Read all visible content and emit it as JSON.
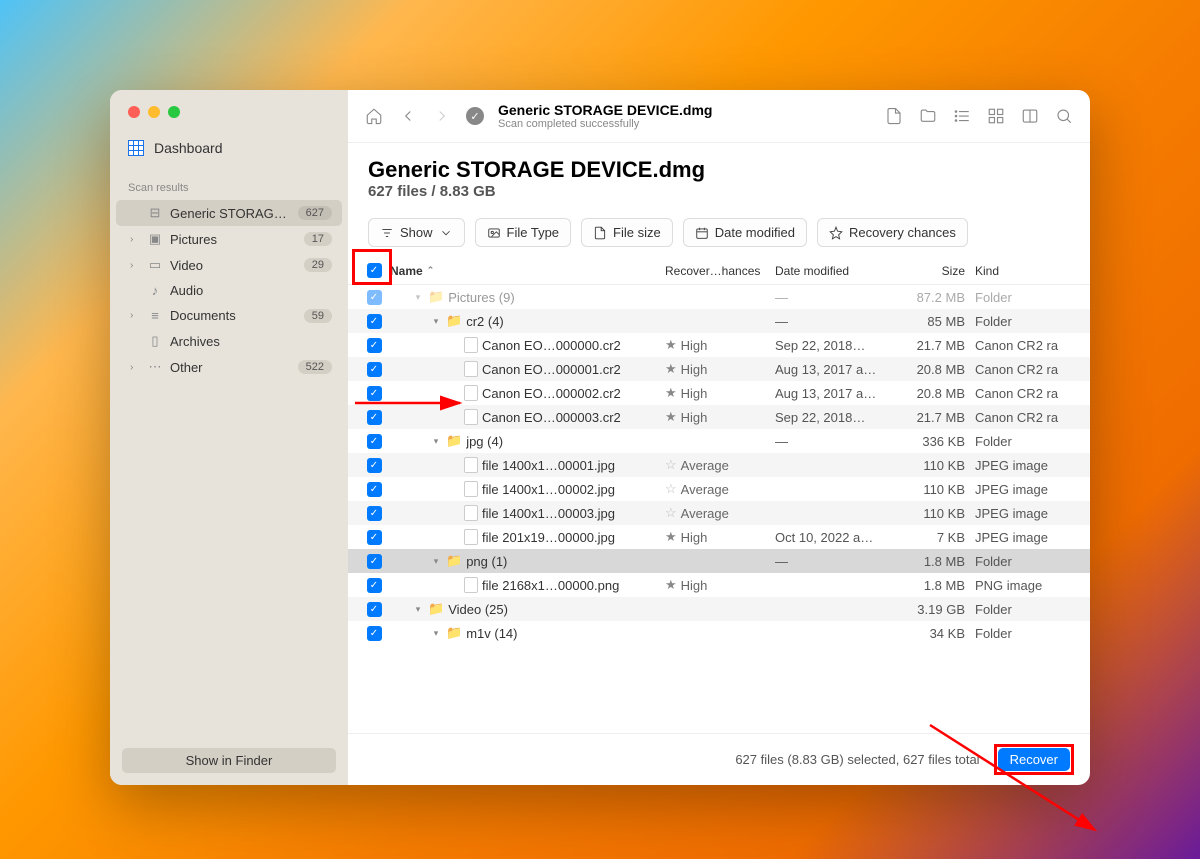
{
  "sidebar": {
    "dashboard": "Dashboard",
    "scan_results_header": "Scan results",
    "items": [
      {
        "label": "Generic STORAG…",
        "badge": "627",
        "icon": "drive",
        "active": true,
        "disclose": false
      },
      {
        "label": "Pictures",
        "badge": "17",
        "icon": "image",
        "disclose": true
      },
      {
        "label": "Video",
        "badge": "29",
        "icon": "video",
        "disclose": true
      },
      {
        "label": "Audio",
        "badge": "",
        "icon": "audio",
        "disclose": false
      },
      {
        "label": "Documents",
        "badge": "59",
        "icon": "doc",
        "disclose": true
      },
      {
        "label": "Archives",
        "badge": "",
        "icon": "archive",
        "disclose": false
      },
      {
        "label": "Other",
        "badge": "522",
        "icon": "other",
        "disclose": true
      }
    ],
    "finder_btn": "Show in Finder"
  },
  "toolbar": {
    "title": "Generic STORAGE DEVICE.dmg",
    "subtitle": "Scan completed successfully"
  },
  "header": {
    "title": "Generic STORAGE DEVICE.dmg",
    "subtitle": "627 files / 8.83 GB"
  },
  "filters": {
    "show": "Show",
    "file_type": "File Type",
    "file_size": "File size",
    "date_modified": "Date modified",
    "recovery": "Recovery chances"
  },
  "columns": {
    "name": "Name",
    "rc": "Recover…hances",
    "date": "Date modified",
    "size": "Size",
    "kind": "Kind"
  },
  "rows": [
    {
      "indent": 1,
      "disclose": "open",
      "folder": true,
      "name": "Pictures (9)",
      "rc": "",
      "date": "—",
      "size": "87.2 MB",
      "kind": "Folder",
      "alt": false,
      "faded": true
    },
    {
      "indent": 2,
      "disclose": "open",
      "folder": true,
      "name": "cr2 (4)",
      "rc": "",
      "date": "—",
      "size": "85 MB",
      "kind": "Folder",
      "alt": true
    },
    {
      "indent": 3,
      "file": true,
      "name": "Canon EO…000000.cr2",
      "rc": "High",
      "star": "solid",
      "date": "Sep 22, 2018…",
      "size": "21.7 MB",
      "kind": "Canon CR2 ra"
    },
    {
      "indent": 3,
      "file": true,
      "name": "Canon EO…000001.cr2",
      "rc": "High",
      "star": "solid",
      "date": "Aug 13, 2017 a…",
      "size": "20.8 MB",
      "kind": "Canon CR2 ra",
      "alt": true
    },
    {
      "indent": 3,
      "file": true,
      "name": "Canon EO…000002.cr2",
      "rc": "High",
      "star": "solid",
      "date": "Aug 13, 2017 a…",
      "size": "20.8 MB",
      "kind": "Canon CR2 ra"
    },
    {
      "indent": 3,
      "file": true,
      "name": "Canon EO…000003.cr2",
      "rc": "High",
      "star": "solid",
      "date": "Sep 22, 2018…",
      "size": "21.7 MB",
      "kind": "Canon CR2 ra",
      "alt": true
    },
    {
      "indent": 2,
      "disclose": "open",
      "folder": true,
      "name": "jpg (4)",
      "rc": "",
      "date": "—",
      "size": "336 KB",
      "kind": "Folder"
    },
    {
      "indent": 3,
      "file": true,
      "name": "file 1400x1…00001.jpg",
      "rc": "Average",
      "star": "outline",
      "date": "",
      "size": "110 KB",
      "kind": "JPEG image",
      "alt": true
    },
    {
      "indent": 3,
      "file": true,
      "name": "file 1400x1…00002.jpg",
      "rc": "Average",
      "star": "outline",
      "date": "",
      "size": "110 KB",
      "kind": "JPEG image"
    },
    {
      "indent": 3,
      "file": true,
      "name": "file 1400x1…00003.jpg",
      "rc": "Average",
      "star": "outline",
      "date": "",
      "size": "110 KB",
      "kind": "JPEG image",
      "alt": true
    },
    {
      "indent": 3,
      "file": true,
      "name": "file 201x19…00000.jpg",
      "rc": "High",
      "star": "solid",
      "date": "Oct 10, 2022 a…",
      "size": "7 KB",
      "kind": "JPEG image"
    },
    {
      "indent": 2,
      "disclose": "open",
      "folder": true,
      "name": "png (1)",
      "rc": "",
      "date": "—",
      "size": "1.8 MB",
      "kind": "Folder",
      "sel": true
    },
    {
      "indent": 3,
      "file": true,
      "name": "file 2168x1…00000.png",
      "rc": "High",
      "star": "solid",
      "date": "",
      "size": "1.8 MB",
      "kind": "PNG image"
    },
    {
      "indent": 1,
      "disclose": "open",
      "folder": true,
      "name": "Video (25)",
      "rc": "",
      "date": "",
      "size": "3.19 GB",
      "kind": "Folder",
      "alt": true
    },
    {
      "indent": 2,
      "disclose": "open",
      "folder": true,
      "name": "m1v (14)",
      "rc": "",
      "date": "",
      "size": "34 KB",
      "kind": "Folder"
    }
  ],
  "footer": {
    "status": "627 files (8.83 GB) selected, 627 files total",
    "recover": "Recover"
  }
}
